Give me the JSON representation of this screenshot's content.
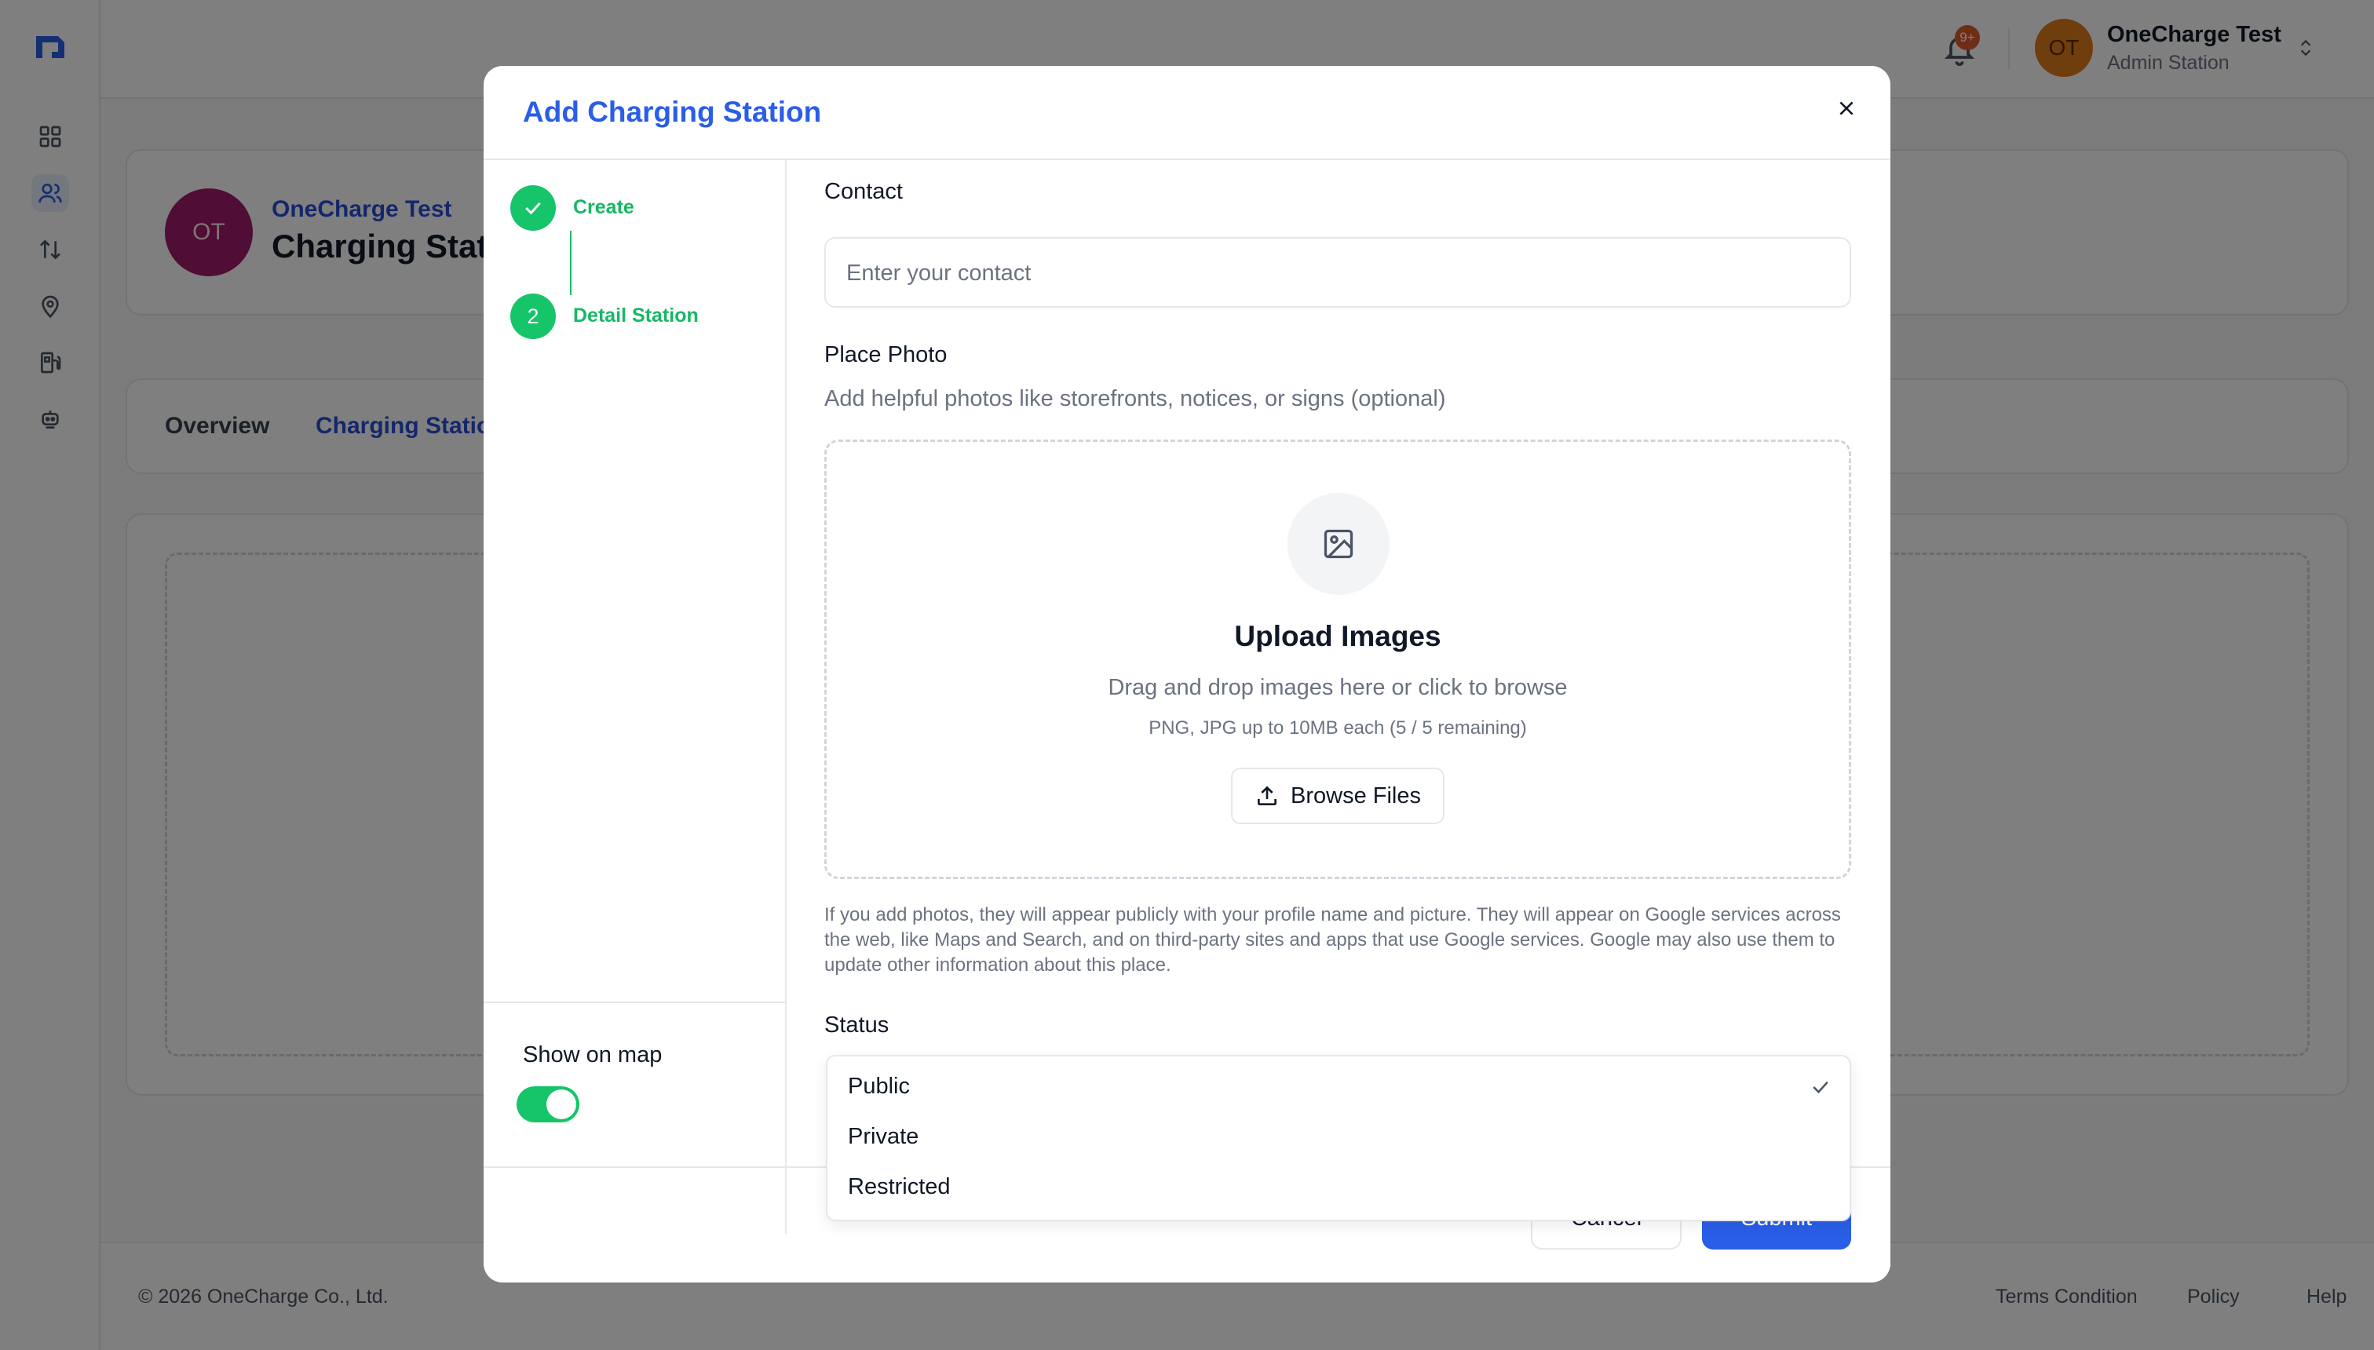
{
  "topbar": {
    "notification_badge": "9+",
    "user_initials": "OT",
    "user_name": "OneCharge Test",
    "user_role": "Admin Station"
  },
  "sidebar": {
    "icons": [
      "dashboard-icon",
      "users-icon",
      "transfer-icon",
      "location-icon",
      "charger-icon",
      "robot-icon"
    ],
    "active_index": 1
  },
  "page": {
    "org_initials": "OT",
    "org_name": "OneCharge Test",
    "org_title": "Charging Stations",
    "tabs": [
      {
        "label": "Overview"
      },
      {
        "label": "Charging Stations"
      }
    ]
  },
  "footer": {
    "copyright": "© 2026 OneCharge Co., Ltd.",
    "links": [
      "Terms Condition",
      "Policy",
      "Help"
    ]
  },
  "modal": {
    "title": "Add Charging Station",
    "steps": [
      {
        "marker": "",
        "label": "Create",
        "done": true
      },
      {
        "marker": "2",
        "label": "Detail Station",
        "done": false
      }
    ],
    "show_on_map_label": "Show on map",
    "show_on_map": true,
    "contact": {
      "label": "Contact",
      "placeholder": "Enter your contact"
    },
    "photo": {
      "label": "Place Photo",
      "description": "Add helpful photos like storefronts, notices, or signs (optional)",
      "upload_title": "Upload Images",
      "upload_subtitle": "Drag and drop images here or click to browse",
      "upload_hint": "PNG, JPG up to 10MB each (5 / 5 remaining)",
      "browse_label": "Browse Files",
      "disclaimer": "If you add photos, they will appear publicly with your profile name and picture. They will appear on Google services across the web, like Maps and Search, and on third-party sites and apps that use Google services. Google may also use them to update other information about this place."
    },
    "status": {
      "label": "Status",
      "selected": "Public",
      "options": [
        "Public",
        "Private",
        "Restricted"
      ]
    },
    "cancel_label": "Cancel",
    "submit_label": "Submit"
  },
  "colors": {
    "accent": "#2a5ee8",
    "success": "#16c46a",
    "overlay": "rgba(0,0,0,0.5)"
  }
}
